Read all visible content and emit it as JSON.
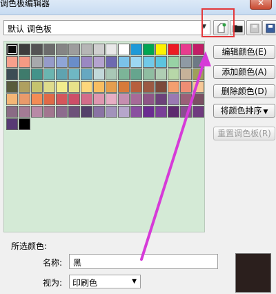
{
  "window": {
    "title": "调色板编辑器",
    "close_glyph": "✕"
  },
  "palette_select": {
    "value": "默认 调色板"
  },
  "toolbar": {
    "buttons": [
      {
        "name": "new-palette-icon"
      },
      {
        "name": "open-palette-icon"
      },
      {
        "name": "save-palette-icon"
      },
      {
        "name": "save-as-palette-icon"
      }
    ]
  },
  "swatches": [
    "#0c0c0c",
    "#3d3d3d",
    "#545454",
    "#6c6c6c",
    "#858585",
    "#9d9d9d",
    "#b6b6b6",
    "#cfcfcf",
    "#e9e9e9",
    "#ffffff",
    "#1e9ad8",
    "#00a651",
    "#fff200",
    "#ec1c24",
    "#e83d8e",
    "#c21e66",
    "#f7a08c",
    "#f59a84",
    "#a7a9ac",
    "#959bc9",
    "#8fa5d6",
    "#6a8dc9",
    "#9a88c2",
    "#b4a3cf",
    "#6e6ab0",
    "#7bc2e8",
    "#9dd7f2",
    "#71c9e8",
    "#5cc4de",
    "#98d2a5",
    "#8f9aa4",
    "#6d7a85",
    "#3d4d55",
    "#3f7b6c",
    "#43938a",
    "#6ab5b0",
    "#5fa3b0",
    "#6fb7c4",
    "#66a8c1",
    "#c2d8da",
    "#a9c8b6",
    "#7cb598",
    "#66a58e",
    "#8fbda1",
    "#b0ceb4",
    "#b7d7a8",
    "#c7b299",
    "#9f9f5a",
    "#585c3c",
    "#afa060",
    "#c5c36e",
    "#dedc8c",
    "#f1ec8d",
    "#e8e28a",
    "#fdd77c",
    "#f8be61",
    "#e59e4e",
    "#d77a3a",
    "#b75f3d",
    "#9b5a43",
    "#7c4a3b",
    "#f39f6f",
    "#ee8e74",
    "#f6c896",
    "#f4b676",
    "#e99a6b",
    "#f38c55",
    "#e06a47",
    "#d5565b",
    "#cd4e68",
    "#d46d8a",
    "#df97b0",
    "#e7aec4",
    "#c58eb0",
    "#a76a98",
    "#8e5587",
    "#6c417a",
    "#9a79b3",
    "#9b5f78",
    "#7a4f63",
    "#8a6b85",
    "#a47b95",
    "#b88aa6",
    "#a2768f",
    "#8d6c8e",
    "#6d527a",
    "#54406a",
    "#8a73a4",
    "#a293bb",
    "#b6a6cb",
    "#8a4fa0",
    "#6b2c91",
    "#7a3f98",
    "#5d2a6f",
    "#8a4e91",
    "#6f3b7f",
    "#583a74",
    "#000000"
  ],
  "buttons": {
    "edit_color": "编辑颜色(E)",
    "add_color": "添加颜色(A)",
    "delete_color": "删除颜色(D)",
    "sort_colors": "将颜色排序",
    "reset_palette": "重置调色板(R)",
    "sort_caret": "▼"
  },
  "selected_color": {
    "section_label": "所选颜色:",
    "name_label": "名称:",
    "name_value": "黑",
    "view_label": "视为:",
    "view_value": "印刷色",
    "swatch_color": "#2b1f1d"
  },
  "annotation_colors": {
    "highlight": "#e3383b",
    "arrow": "#d63bd8"
  }
}
